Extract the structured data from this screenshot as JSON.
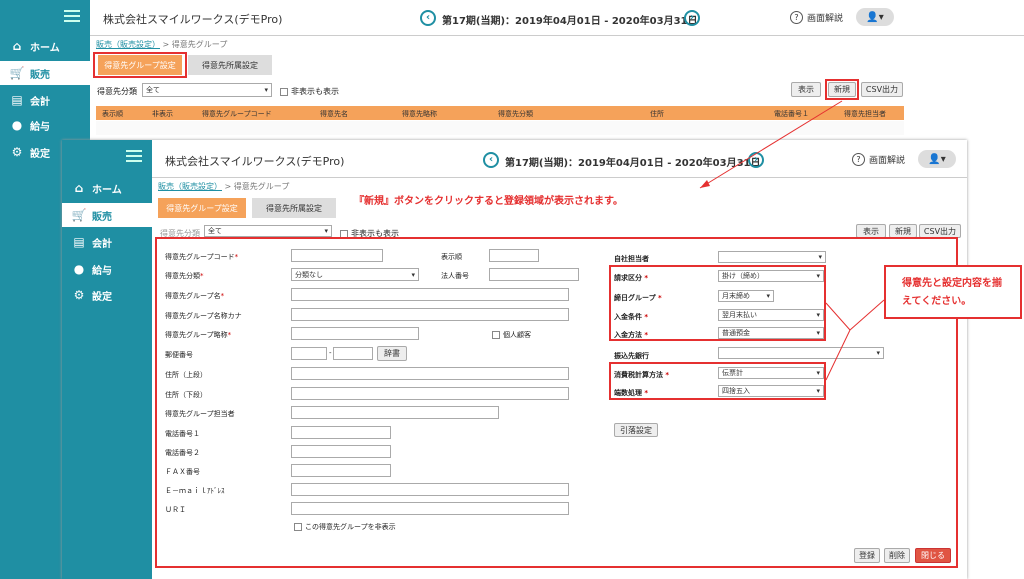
{
  "app": {
    "company": "株式会社スマイルワークス(デモPro)",
    "period": "第17期(当期)：2019年04月01日 - 2020年03月31日",
    "help": "画面解説"
  },
  "nav": [
    {
      "label": "ホーム",
      "icon": "⌂"
    },
    {
      "label": "販売",
      "icon": "🛒"
    },
    {
      "label": "会計",
      "icon": "▤"
    },
    {
      "label": "給与",
      "icon": "💰"
    },
    {
      "label": "設定",
      "icon": "⚙"
    }
  ],
  "crumb": {
    "link": "販売（販売設定）",
    "sep": " > ",
    "current": "得意先グループ"
  },
  "tabs": [
    "得意先グループ設定",
    "得意先所属設定"
  ],
  "filter": {
    "label": "得意先分類",
    "value": "全て",
    "hidden_cb": "非表示も表示"
  },
  "buttons": {
    "show": "表示",
    "new": "新規",
    "csv": "CSV出力"
  },
  "columns": [
    "表示順",
    "非表示",
    "得意先グループコード",
    "得意先名",
    "得意先略称",
    "得意先分類",
    "住所",
    "電話番号１",
    "得意先担当者"
  ],
  "annotation_top": "『新規』ボタンをクリックすると登録領域が表示されます。",
  "annotation_right": "得意先と設定内容を揃えてください。",
  "form": {
    "code": "得意先グループコード",
    "order": "表示順",
    "category": "得意先分類",
    "category_val": "分類なし",
    "corp_no": "法人番号",
    "name": "得意先グループ名",
    "kana": "得意先グループ名称カナ",
    "short": "得意先グループ略称",
    "personal": "個人顧客",
    "zip": "郵便番号",
    "dict": "辞書",
    "addr1": "住所（上段）",
    "addr2": "住所（下段）",
    "person": "得意先グループ担当者",
    "tel1": "電話番号１",
    "tel2": "電話番号２",
    "fax": "ＦＡＸ番号",
    "email": "Ｅ－ｍａｉｌｱﾄﾞﾚｽ",
    "url": "ＵＲＩ",
    "hide_cb": "この得意先グループを非表示",
    "own_staff": "自社担当者",
    "billing": "請求区分",
    "billing_val": "掛け（締め）",
    "closing": "締日グループ",
    "closing_val": "月末締め",
    "pay_cond": "入金条件",
    "pay_cond_val": "翌月末払い",
    "pay_method": "入金方法",
    "pay_method_val": "普通預金",
    "bank": "振込先銀行",
    "tax_calc": "消費税計算方法",
    "tax_calc_val": "伝票計",
    "rounding": "端数処理",
    "rounding_val": "四捨五入",
    "shortcut": "引落設定",
    "register": "登録",
    "delete": "削除",
    "close": "閉じる"
  },
  "colors": {
    "accent": "#1f8fa3",
    "tab": "#f5a25a",
    "annotation": "#e53030"
  }
}
